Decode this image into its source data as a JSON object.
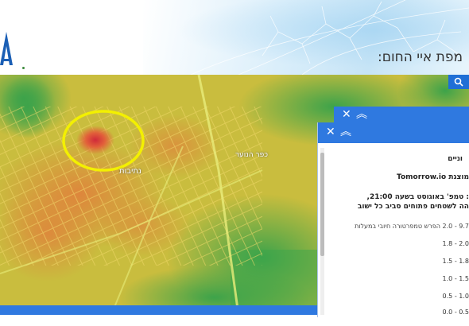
{
  "header": {
    "title": "מפת איי החום:",
    "search_icon": "search-icon"
  },
  "map": {
    "labels": [
      "נתיבות",
      "כפר הנוער"
    ],
    "highlight_color": "#f3f000"
  },
  "legend_panel": {
    "heading": "וניים",
    "source": "מוצגת Tomorrow.io",
    "description_line1": ": טמפ' באוגוסט בשעה 21:00,",
    "description_line2": "הה לשטחים פתוחים סביב כל ישוב",
    "units": "9.7 - 2.0 הפרש טמפרטורה חיובי במעלות",
    "ranges": [
      "2.0 - 1.8",
      "1.8 - 1.5",
      "1.5 - 1.0",
      "1.0 - 0.5",
      "0.5 - 0.0"
    ]
  }
}
